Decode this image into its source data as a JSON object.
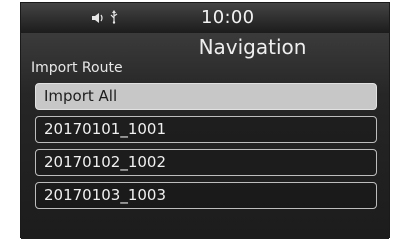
{
  "status_bar": {
    "time": "10:00",
    "icons": [
      "speaker-icon",
      "usb-icon"
    ]
  },
  "screen": {
    "title": "Navigation",
    "section_label": "Import Route"
  },
  "list": {
    "items": [
      {
        "label": "Import All",
        "selected": true
      },
      {
        "label": "20170101_1001",
        "selected": false
      },
      {
        "label": "20170102_1002",
        "selected": false
      },
      {
        "label": "20170103_1003",
        "selected": false
      }
    ]
  },
  "colors": {
    "background": "#2a2a2a",
    "selected_row": "#c7c7c7",
    "row_border": "#bdbdbd"
  }
}
